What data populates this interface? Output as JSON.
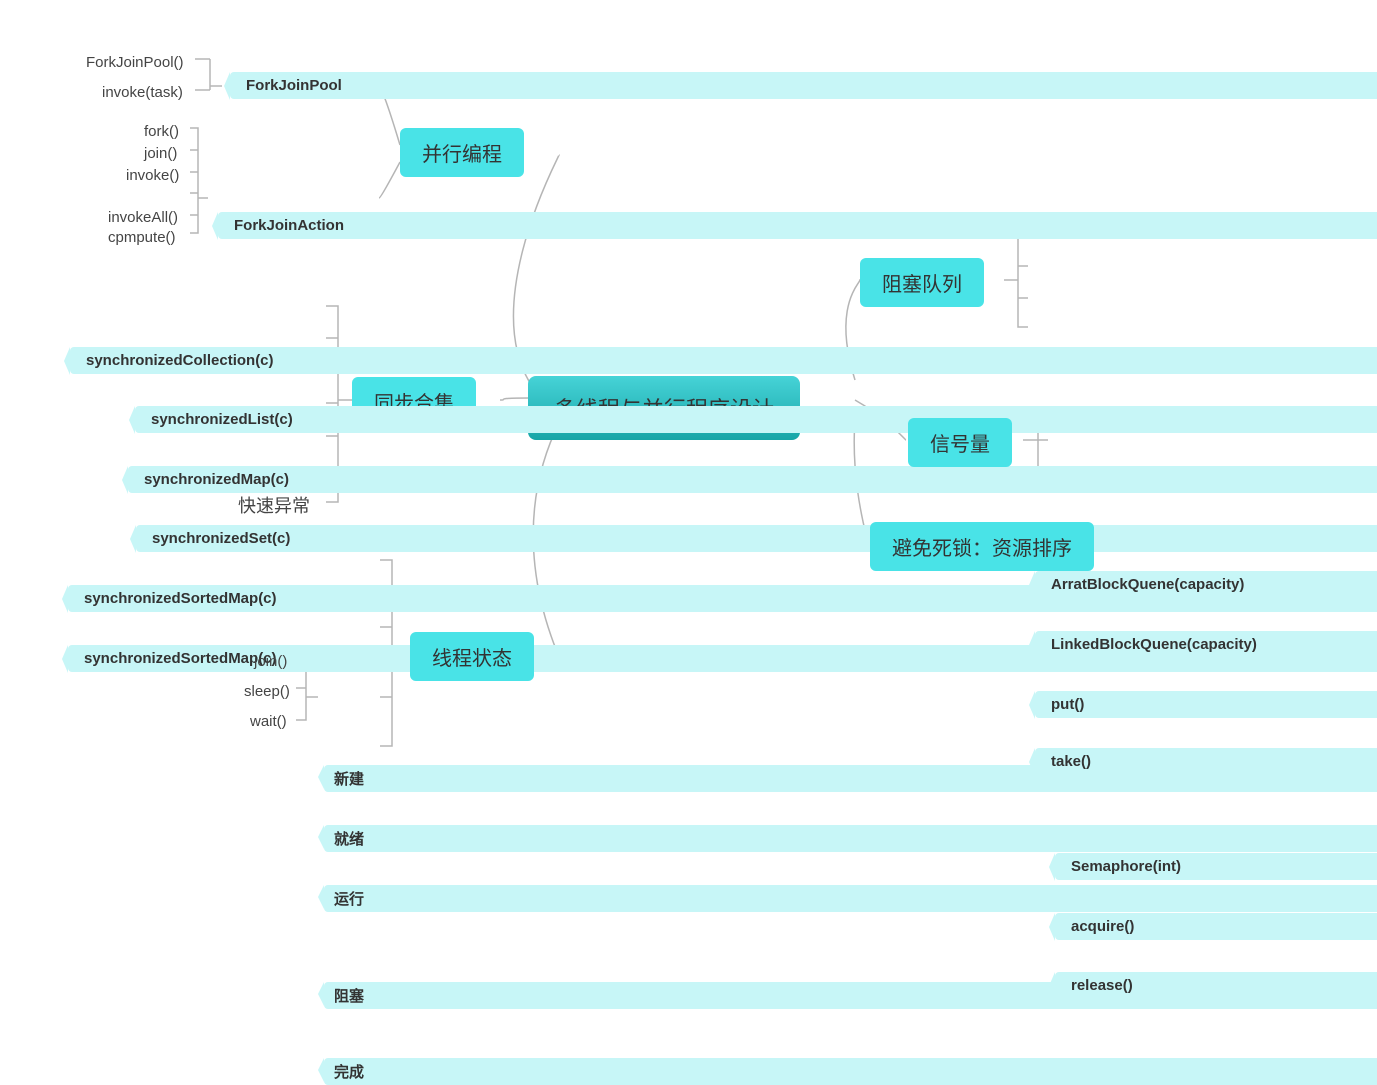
{
  "root": "多线程与并行程序设计",
  "left": {
    "parallel": {
      "label": "并行编程",
      "forkJoinPool": {
        "label": "ForkJoinPool",
        "children": [
          "ForkJoinPool()",
          "invoke(task)"
        ]
      },
      "forkJoinAction": {
        "label": "ForkJoinAction",
        "children": [
          "fork()",
          "join()",
          "invoke()",
          "invokeAll()",
          "cpmpute()"
        ]
      }
    },
    "syncCollection": {
      "label": "同步合集",
      "children": [
        "synchronizedCollection(c)",
        "synchronizedList(c)",
        "synchronizedMap(c)",
        "synchronizedSet(c)",
        "synchronizedSortedMap(c)",
        "synchronizedSortedMap(c)",
        "快速异常"
      ]
    },
    "threadState": {
      "label": "线程状态",
      "states": {
        "new": "新建",
        "ready": "就绪",
        "running": "运行",
        "blocked": "阻塞",
        "done": "完成"
      },
      "blockedChildren": [
        "join()",
        "sleep()",
        "wait()"
      ]
    }
  },
  "right": {
    "blockQueue": {
      "label": "阻塞队列",
      "children": [
        "ArratBlockQuene(capacity)",
        "LinkedBlockQuene(capacity)",
        "put()",
        "take()"
      ]
    },
    "semaphore": {
      "label": "信号量",
      "children": [
        "Semaphore(int)",
        "acquire()",
        "release()"
      ]
    },
    "deadlock": {
      "label": "避免死锁：资源排序"
    }
  }
}
